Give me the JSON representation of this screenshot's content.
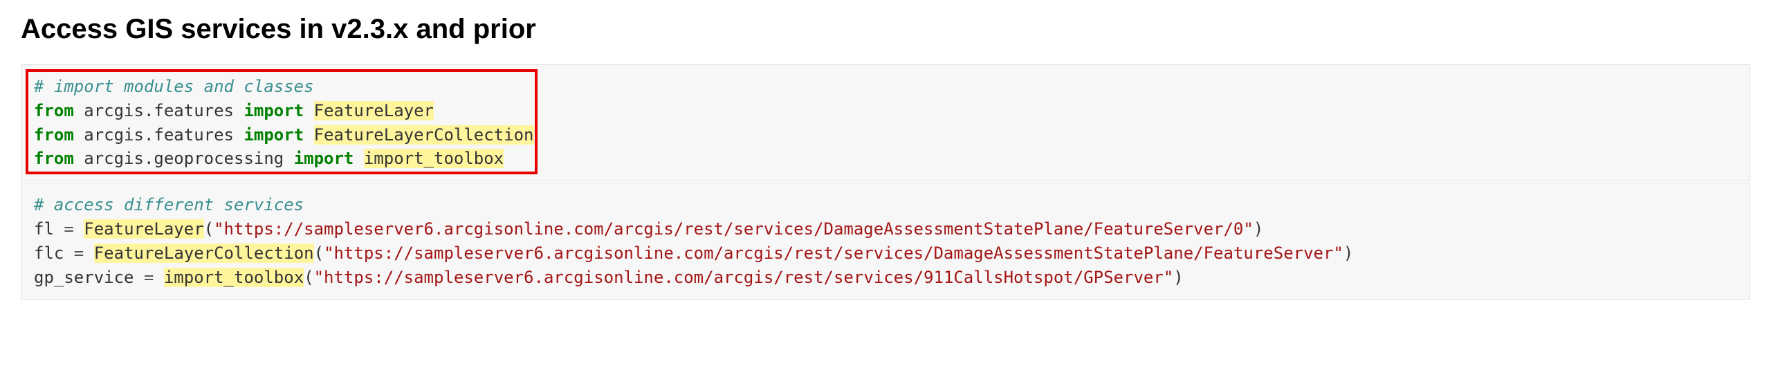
{
  "heading": "Access GIS services in v2.3.x and prior",
  "code1": {
    "comment": "# import modules and classes",
    "kw_from": "from",
    "kw_import": "import",
    "mod_features": "arcgis.features",
    "mod_geoproc": "arcgis.geoprocessing",
    "cls_FeatureLayer": "FeatureLayer",
    "cls_FeatureLayerCollection": "FeatureLayerCollection",
    "fn_import_toolbox": "import_toolbox"
  },
  "code2": {
    "comment": "# access different services",
    "var_fl": "fl",
    "var_flc": "flc",
    "var_gp": "gp_service",
    "eq": " = ",
    "call_FeatureLayer": "FeatureLayer",
    "call_FeatureLayerCollection": "FeatureLayerCollection",
    "call_import_toolbox": "import_toolbox",
    "lp": "(",
    "rp": ")",
    "str1": "\"https://sampleserver6.arcgisonline.com/arcgis/rest/services/DamageAssessmentStatePlane/FeatureServer/0\"",
    "str2": "\"https://sampleserver6.arcgisonline.com/arcgis/rest/services/DamageAssessmentStatePlane/FeatureServer\"",
    "str3": "\"https://sampleserver6.arcgisonline.com/arcgis/rest/services/911CallsHotspot/GPServer\""
  }
}
